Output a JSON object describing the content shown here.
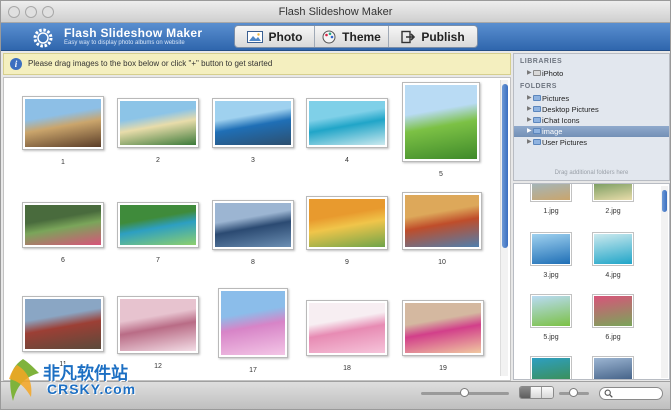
{
  "window": {
    "title": "Flash Slideshow Maker"
  },
  "app": {
    "name": "Flash Slideshow Maker",
    "tagline": "Easy way to display photo albums on website"
  },
  "tabs": [
    {
      "label": "Photo",
      "icon": "photo-icon"
    },
    {
      "label": "Theme",
      "icon": "theme-icon"
    },
    {
      "label": "Publish",
      "icon": "publish-icon"
    }
  ],
  "info": {
    "text": "Please drag images to the box below or click \"+\" button to get started"
  },
  "photos": [
    {
      "label": "1",
      "colors": [
        "#8dbfe6",
        "#caa56c",
        "#5a3d28"
      ]
    },
    {
      "label": "2",
      "colors": [
        "#8cc4e7",
        "#e8dcaa",
        "#3c7a3a"
      ]
    },
    {
      "label": "3",
      "colors": [
        "#9fd1ef",
        "#1f6fb6",
        "#2d4f6e"
      ]
    },
    {
      "label": "4",
      "colors": [
        "#7fd0e8",
        "#20a5c8",
        "#cbe9ee"
      ]
    },
    {
      "label": "5",
      "colors": [
        "#b9dbf4",
        "#7cc145",
        "#3f8a2a"
      ]
    },
    {
      "label": "6",
      "colors": [
        "#496b3d",
        "#7aa55a",
        "#d8547a"
      ]
    },
    {
      "label": "7",
      "colors": [
        "#3f8b3b",
        "#2d9fc2",
        "#8ed06d"
      ]
    },
    {
      "label": "8",
      "colors": [
        "#9cb5d2",
        "#2b4a72",
        "#6c8fb3"
      ]
    },
    {
      "label": "9",
      "colors": [
        "#e89a2e",
        "#f0c54a",
        "#6ea44a"
      ]
    },
    {
      "label": "10",
      "colors": [
        "#dda85a",
        "#bf4d2a",
        "#4f7fae"
      ]
    },
    {
      "label": "11",
      "colors": [
        "#8aa6c4",
        "#9c3f35",
        "#5b4a3b"
      ]
    },
    {
      "label": "12",
      "colors": [
        "#e7c3cf",
        "#b96c86",
        "#f3dde6"
      ]
    },
    {
      "label": "17",
      "colors": [
        "#8bbdea",
        "#d784c7",
        "#f3c6e6"
      ]
    },
    {
      "label": "18",
      "colors": [
        "#f7eef2",
        "#e78bb3",
        "#f6c4da"
      ]
    },
    {
      "label": "19",
      "colors": [
        "#d4b8a0",
        "#d23f8a",
        "#f0c8a0"
      ]
    }
  ],
  "sidebar": {
    "libraries_header": "LIBRARIES",
    "libraries": [
      {
        "label": "iPhoto"
      }
    ],
    "folders_header": "FOLDERS",
    "folders": [
      {
        "label": "Pictures",
        "selected": false
      },
      {
        "label": "Desktop Pictures",
        "selected": false
      },
      {
        "label": "iChat Icons",
        "selected": false
      },
      {
        "label": "image",
        "selected": true
      },
      {
        "label": "User Pictures",
        "selected": false
      }
    ],
    "drag_hint": "Drag additional folders here"
  },
  "thumbs": [
    {
      "label": "1.jpg",
      "colors": [
        "#caa56c",
        "#8dbfe6"
      ]
    },
    {
      "label": "2.jpg",
      "colors": [
        "#e8dcaa",
        "#3c7a3a"
      ]
    },
    {
      "label": "3.jpg",
      "colors": [
        "#1f6fb6",
        "#9fd1ef"
      ]
    },
    {
      "label": "4.jpg",
      "colors": [
        "#20a5c8",
        "#cbe9ee"
      ]
    },
    {
      "label": "5.jpg",
      "colors": [
        "#7cc145",
        "#b9dbf4"
      ]
    },
    {
      "label": "6.jpg",
      "colors": [
        "#7aa55a",
        "#d8547a"
      ]
    },
    {
      "label": "",
      "colors": [
        "#3f8b3b",
        "#2d9fc2"
      ]
    },
    {
      "label": "",
      "colors": [
        "#2b4a72",
        "#9cb5d2"
      ]
    }
  ],
  "watermark": {
    "brand": "非凡软件站",
    "domain": "CRSKY.com"
  },
  "colors": {
    "accent": "#3b6fc0",
    "header": "#3a70b5",
    "info_bg": "#f4efbf",
    "selection": "#7f9cc3"
  }
}
